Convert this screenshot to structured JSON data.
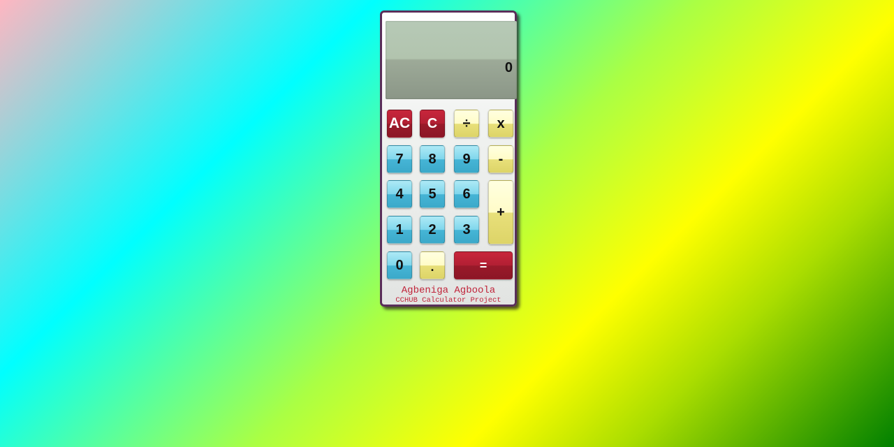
{
  "display": {
    "value": "0"
  },
  "keys": {
    "all_clear": "AC",
    "clear": "C",
    "divide": "÷",
    "multiply": "x",
    "seven": "7",
    "eight": "8",
    "nine": "9",
    "subtract": "-",
    "four": "4",
    "five": "5",
    "six": "6",
    "add": "+",
    "one": "1",
    "two": "2",
    "three": "3",
    "zero": "0",
    "decimal": ".",
    "equals": "="
  },
  "credits": {
    "author": "Agbeniga Agboola",
    "project": "CCHUB Calculator Project"
  },
  "colors": {
    "frame": "#5a2e5a",
    "operator_red": "#b21f33",
    "digit_blue": "#46b5d6",
    "operator_yellow": "#e8e07a",
    "credit_text": "#c0243a"
  }
}
